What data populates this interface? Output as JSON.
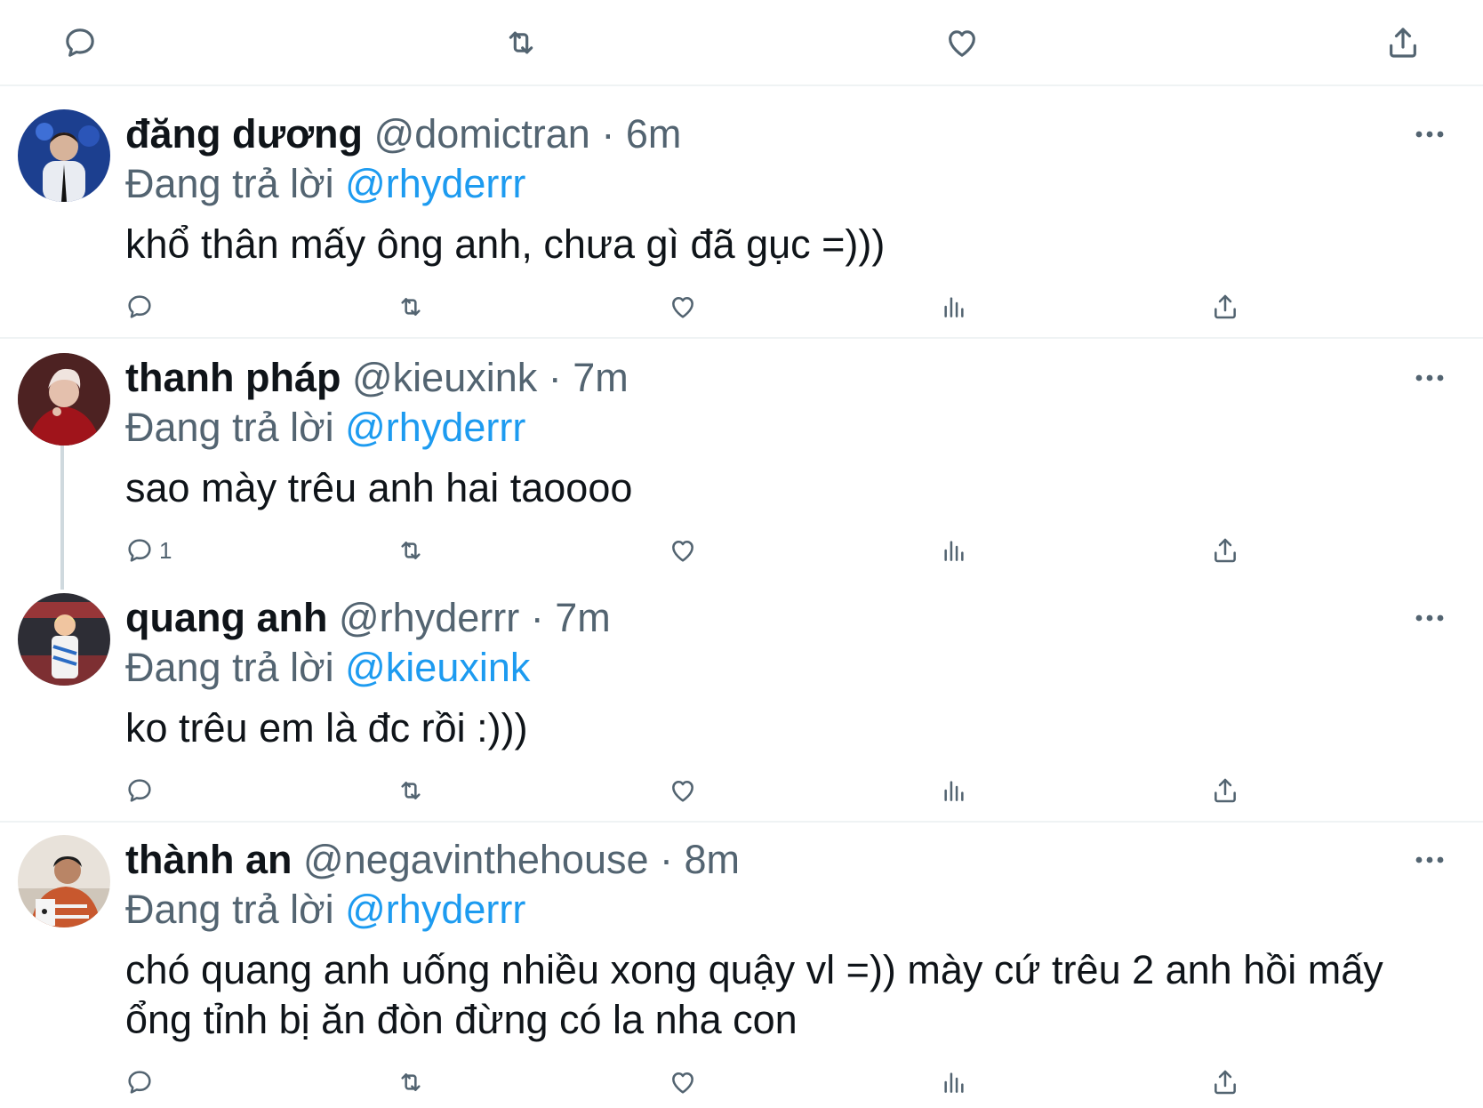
{
  "tweets": [
    {
      "name": "đăng dương",
      "handle": "@domictran",
      "dot": "·",
      "time": "6m",
      "replying_prefix": "Đang trả lời",
      "replying_to": "@rhyderrr",
      "text": "khổ thân mấy ông anh, chưa gì đã gục =)))",
      "reply_count": ""
    },
    {
      "name": "thanh pháp",
      "handle": "@kieuxink",
      "dot": "·",
      "time": "7m",
      "replying_prefix": "Đang trả lời",
      "replying_to": "@rhyderrr",
      "text": "sao mày trêu anh hai taoooo",
      "reply_count": "1"
    },
    {
      "name": "quang anh",
      "handle": "@rhyderrr",
      "dot": "·",
      "time": "7m",
      "replying_prefix": "Đang trả lời",
      "replying_to": "@kieuxink",
      "text": "ko trêu em là đc rồi :)))",
      "reply_count": ""
    },
    {
      "name": "thành an",
      "handle": "@negavinthehouse",
      "dot": "·",
      "time": "8m",
      "replying_prefix": "Đang trả lời",
      "replying_to": "@rhyderrr",
      "text": "chó quang anh uống nhiều xong quậy vl =)) mày cứ trêu 2 anh hồi mấy ổng tỉnh bị ăn đòn đừng có la nha con",
      "reply_count": ""
    }
  ],
  "icons": {
    "reply": "reply-icon",
    "retweet": "retweet-icon",
    "like": "heart-icon",
    "analytics": "analytics-icon",
    "share": "share-icon",
    "more": "more-icon"
  },
  "colors": {
    "mention": "#1d9bf0",
    "secondary_text": "#536471",
    "divider": "#eff3f4"
  }
}
